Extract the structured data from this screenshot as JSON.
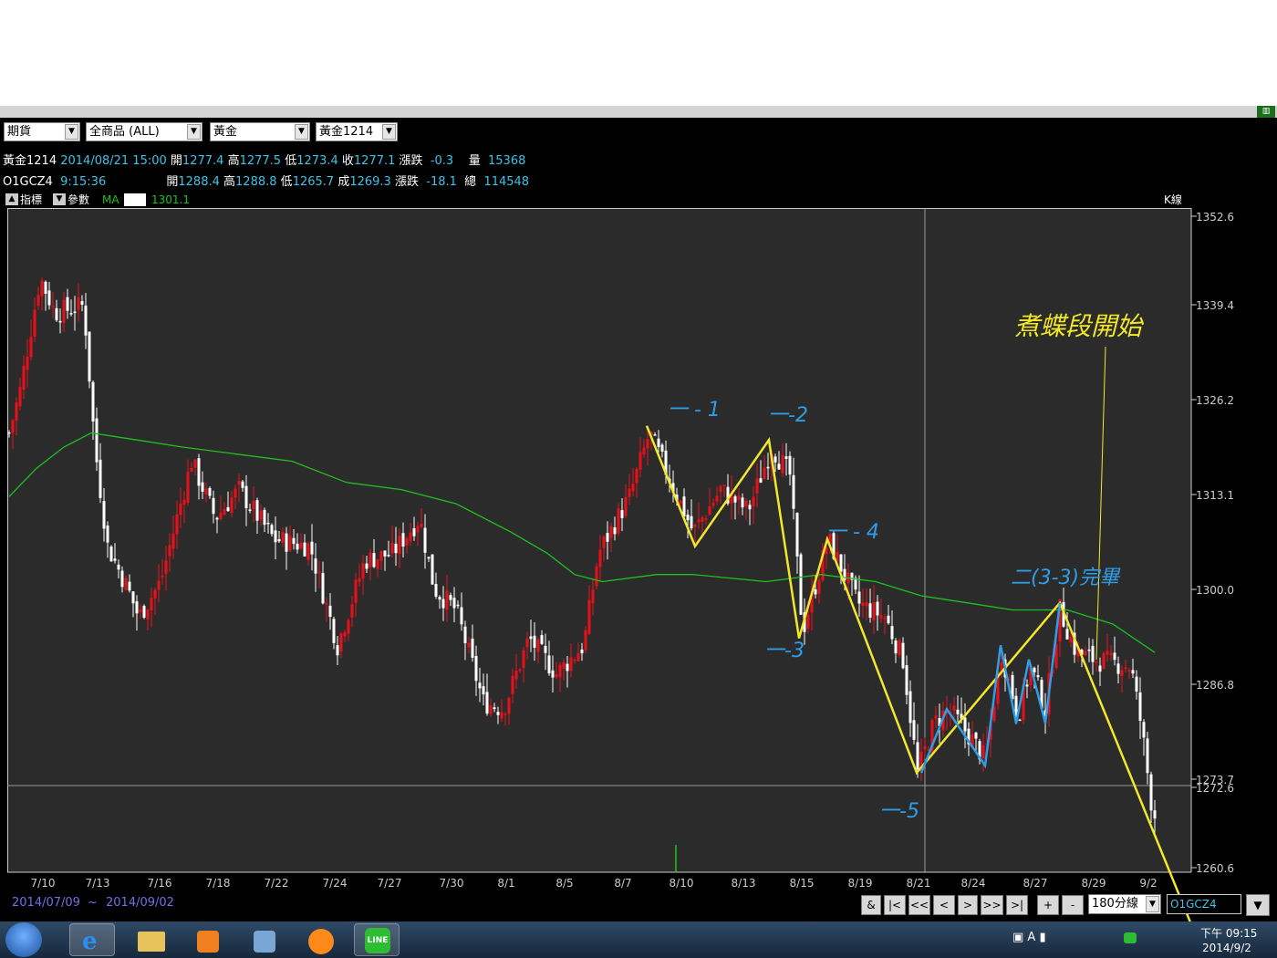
{
  "toolbar": {
    "selects": [
      "期貨",
      "全商品     (ALL)",
      "黃金",
      "黃金1214"
    ]
  },
  "quote1": {
    "name": "黃金1214",
    "datetime": "2014/08/21 15:00",
    "open_label": "開",
    "open": "1277.4",
    "high_label": "高",
    "high": "1277.5",
    "low_label": "低",
    "low": "1273.4",
    "close_label": "收",
    "close": "1277.1",
    "change_label": "漲跌",
    "change": "-0.3",
    "vol_label": "量",
    "vol": "15368"
  },
  "quote2": {
    "name": "O1GCZ4",
    "time": "9:15:36",
    "open_label": "開",
    "open": "1288.4",
    "high_label": "高",
    "high": "1288.8",
    "low_label": "低",
    "low": "1265.7",
    "close_label": "成",
    "close": "1269.3",
    "change_label": "漲跌",
    "change": "-18.1",
    "vol_label": "總",
    "vol": "114548"
  },
  "indicator": {
    "btn1": "指標",
    "btn2": "參數",
    "ma_label": "MA",
    "ma_value": "1301.1",
    "kline_label": "K線"
  },
  "chart_data": {
    "type": "candlestick",
    "y_ticks": [
      "1352.6",
      "1339.4",
      "1326.2",
      "1313.1",
      "1300.0",
      "1286.8",
      "1273.7",
      "1272.6",
      "1260.6"
    ],
    "x_ticks": [
      "7/10",
      "7/13",
      "7/16",
      "7/18",
      "7/22",
      "7/24",
      "7/27",
      "7/30",
      "8/1",
      "8/5",
      "8/7",
      "8/10",
      "8/13",
      "8/15",
      "8/19",
      "8/21",
      "8/24",
      "8/27",
      "8/29",
      "9/2"
    ],
    "ylim": [
      1260.6,
      1352.6
    ],
    "date_range_start": "2014/07/09",
    "date_range_sep": "~",
    "date_range_end": "2014/09/02",
    "annotations": {
      "title": "煮蝶段開始",
      "w1": "一 - 1",
      "w2": "一-2",
      "w3": "一-3",
      "w4": "一 - 4",
      "w5": "一-5",
      "done": "二(3-3)完畢"
    },
    "colors": {
      "up": "#e8101a",
      "down": "#ffffff",
      "ma": "#1fc11f",
      "wave": "#f2e72b",
      "sub": "#2e9de6",
      "bg": "#2b2b2b"
    }
  },
  "navigation": {
    "buttons": [
      "&",
      "|<",
      "<<",
      "<",
      ">",
      ">>",
      ">|",
      "+",
      "-"
    ],
    "period": "180分線",
    "symbol": "O1GCZ4"
  },
  "taskbar": {
    "time": "下午 09:15",
    "date": "2014/9/2"
  }
}
